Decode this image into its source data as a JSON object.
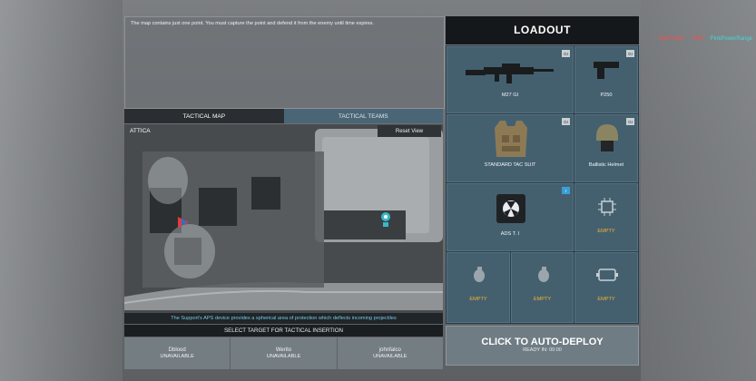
{
  "hud": {
    "players": [
      {
        "name": "BoxFunfor",
        "color": "#ff4a4a"
      },
      {
        "name": "TWP",
        "color": "#ff4a4a"
      },
      {
        "name": "PinkPowerRange",
        "color": "#3fd9d9"
      }
    ]
  },
  "briefing": {
    "text": "The map contains just one point. You must capture the point and defend it from the enemy until time expires."
  },
  "tabs": [
    {
      "label": "TACTICAL MAP",
      "active": true
    },
    {
      "label": "TACTICAL TEAMS",
      "active": false
    }
  ],
  "map": {
    "name": "ATTICA",
    "reset_label": "Reset View",
    "note": "The Support's APS device provides a spherical area of protection which deflects incoming projectiles"
  },
  "insertion": {
    "header": "SELECT TARGET FOR TACTICAL INSERTION",
    "targets": [
      {
        "name": "Dblood",
        "status": "UNAVAILABLE"
      },
      {
        "name": "Werito",
        "status": "UNAVAILABLE"
      },
      {
        "name": "johnfalco",
        "status": "UNAVAILABLE"
      }
    ]
  },
  "loadout": {
    "title": "LOADOUT",
    "primary": {
      "label": "M27 GI",
      "badge": "GI"
    },
    "secondary": {
      "label": "P250",
      "badge": "GI"
    },
    "armor": {
      "label": "STANDARD TAC SUIT",
      "badge": "GI"
    },
    "helmet": {
      "label": "Ballistic Helmet",
      "badge": "GI"
    },
    "equipment": {
      "label": "ADS T. I",
      "badge": "I"
    },
    "chip_slot": {
      "label": "EMPTY"
    },
    "grenade_1": {
      "label": "EMPTY"
    },
    "grenade_2": {
      "label": "EMPTY"
    },
    "gadget": {
      "label": "EMPTY"
    }
  },
  "deploy": {
    "label": "CLICK TO AUTO-DEPLOY",
    "sub": "READY IN: 00:00"
  }
}
